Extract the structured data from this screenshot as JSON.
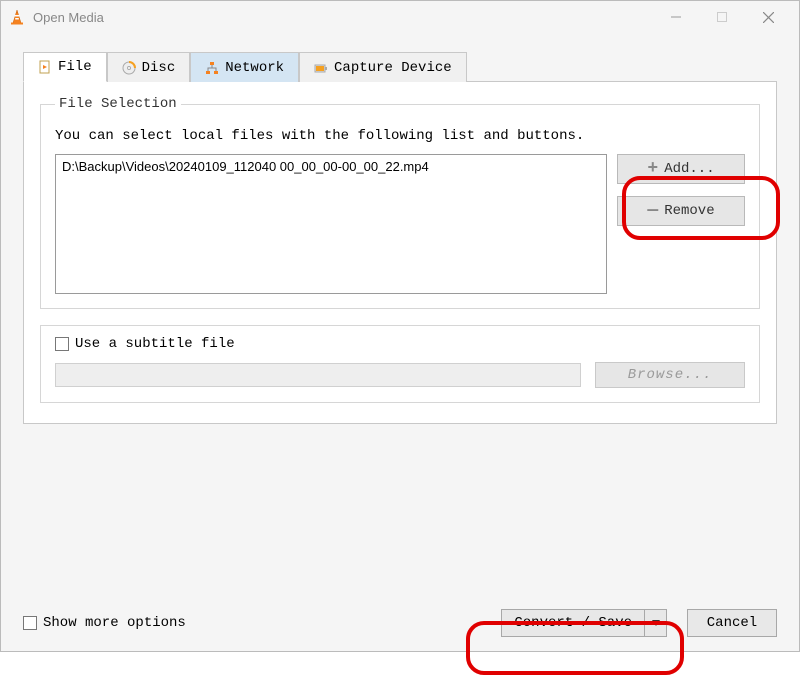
{
  "window": {
    "title": "Open Media"
  },
  "tabs": {
    "file": "File",
    "disc": "Disc",
    "network": "Network",
    "capture": "Capture Device"
  },
  "fileSelection": {
    "legend": "File Selection",
    "help": "You can select local files with the following list and buttons.",
    "files": [
      "D:\\Backup\\Videos\\20240109_112040 00_00_00-00_00_22.mp4"
    ],
    "add": "Add...",
    "remove": "Remove"
  },
  "subtitle": {
    "checkboxLabel": "Use a subtitle file",
    "browse": "Browse..."
  },
  "footer": {
    "showMore": "Show more options",
    "convert": "Convert / Save",
    "cancel": "Cancel"
  }
}
